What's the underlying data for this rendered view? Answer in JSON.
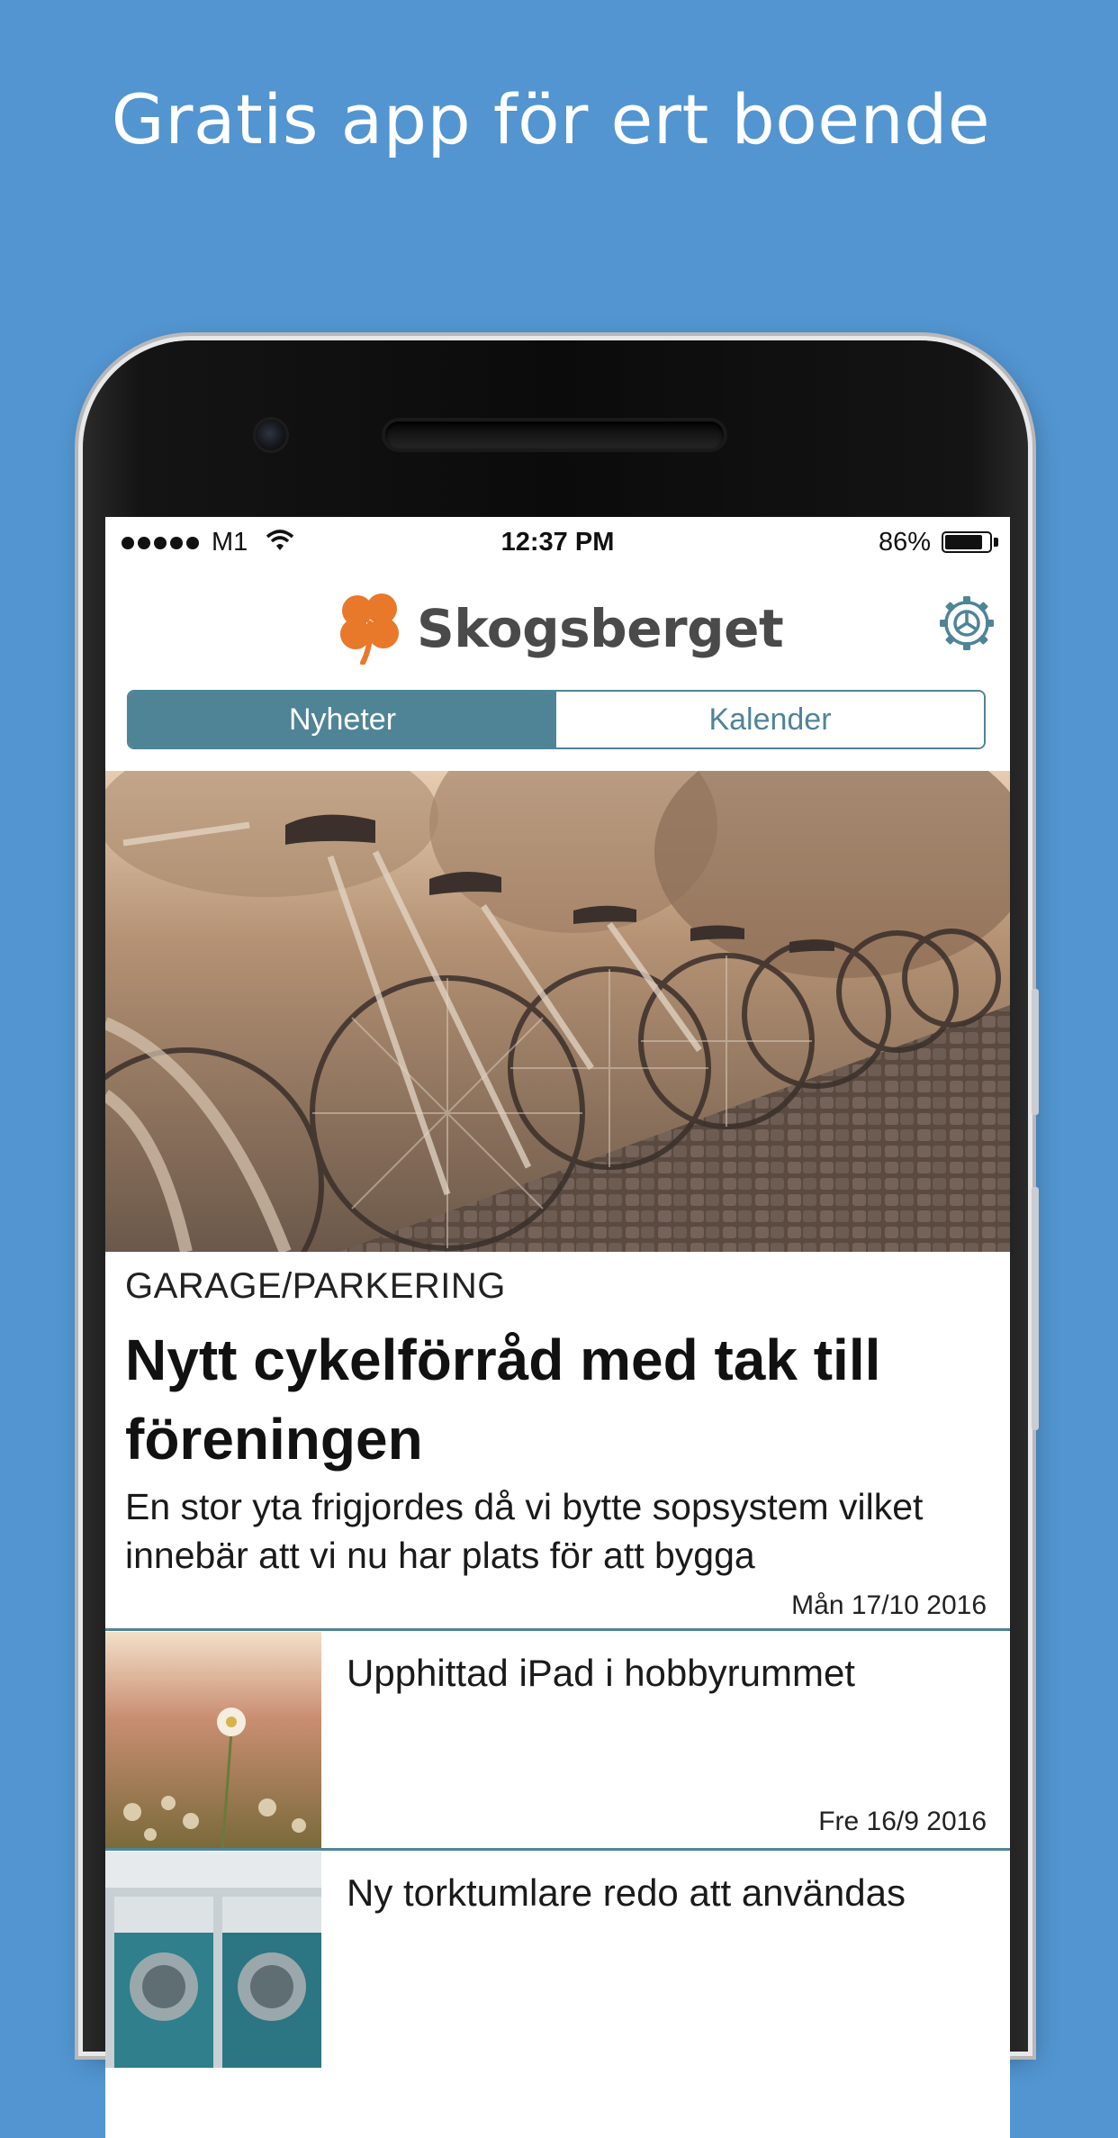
{
  "headline": "Gratis app för ert boende",
  "status_bar": {
    "carrier": "M1",
    "time": "12:37 PM",
    "battery": "86%",
    "battery_level": 0.86
  },
  "header": {
    "brand": "Skogsberget",
    "settings_icon": "gear-icon",
    "logo_icon": "clover-icon"
  },
  "tabs": [
    {
      "label": "Nyheter",
      "active": true
    },
    {
      "label": "Kalender",
      "active": false
    }
  ],
  "featured": {
    "category": "GARAGE/PARKERING",
    "title": "Nytt cykelförråd med tak till föreningen",
    "excerpt": "En stor yta frigjordes då vi bytte sopsystem vilket innebär att vi nu har plats för att bygga",
    "date": "Mån 17/10 2016"
  },
  "news": [
    {
      "title": "Upphittad iPad i hobbyrummet",
      "date": "Fre 16/9 2016"
    },
    {
      "title": "Ny torktumlare redo att användas",
      "date": ""
    }
  ],
  "colors": {
    "background": "#5295d0",
    "accent": "#4f8497",
    "logo": "#e8782a"
  }
}
